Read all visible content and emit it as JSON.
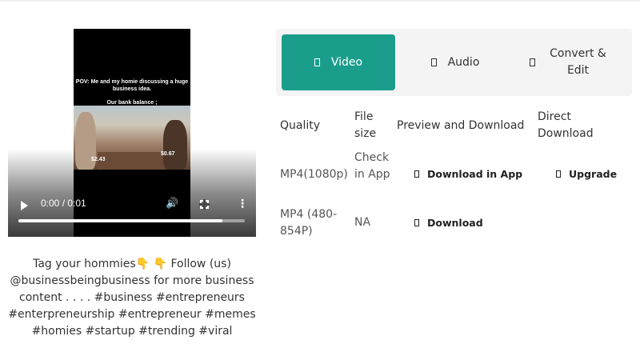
{
  "video": {
    "overlay_caption": "POV: Me and my homie discussing a huge business idea.",
    "overlay_subcaption": "Our bank balance ;",
    "price_left": "$2.43",
    "price_right": "$0.67",
    "time": "0:00 / 0:01",
    "buffered_fraction": 0.9
  },
  "post_caption": "Tag your hommies👇 👇 Follow (us) @businessbeingbusiness for more business content . . . . #business #entrepreneurs #enterpreneurship #entrepreneur #memes #homies #startup #trending #viral",
  "tabs": [
    {
      "label": "Video",
      "icon": "video-icon",
      "active": true
    },
    {
      "label": "Audio",
      "icon": "audio-icon",
      "active": false
    },
    {
      "label": "Convert & Edit",
      "icon": "convert-icon",
      "active": false
    }
  ],
  "table": {
    "headers": [
      "Quality",
      "File size",
      "Preview and Download",
      "Direct Download"
    ],
    "rows": [
      {
        "quality": "MP4(1080p)",
        "size": "Check in App",
        "preview": "Download in App",
        "direct": "Upgrade"
      },
      {
        "quality": "MP4 (480-854P)",
        "size": "NA",
        "preview": "Download",
        "direct": ""
      }
    ]
  },
  "colors": {
    "accent": "#1a9e8b",
    "tab_bg": "#f4f4f4"
  }
}
